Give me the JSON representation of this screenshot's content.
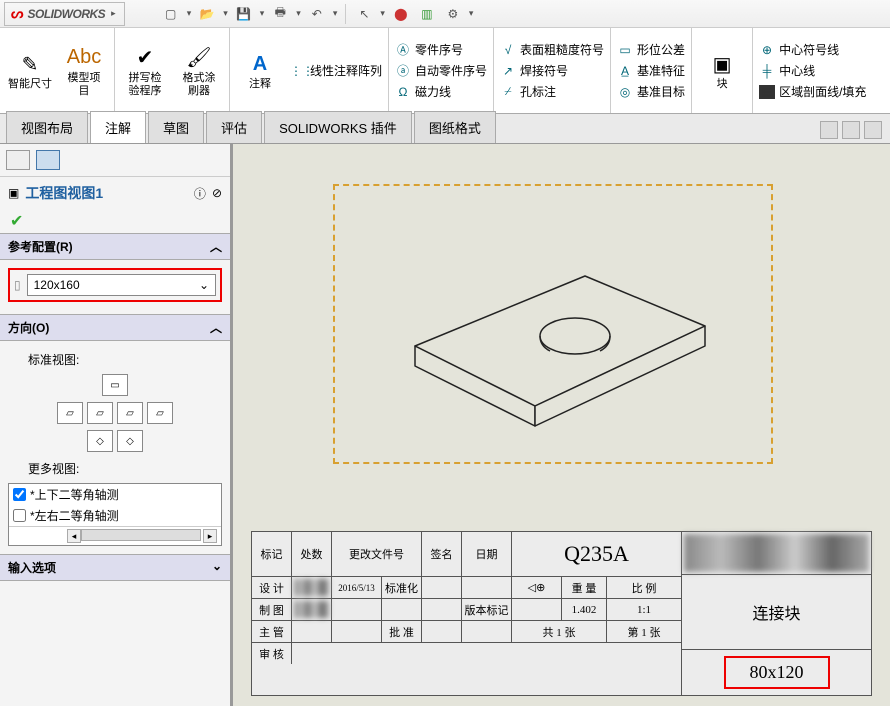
{
  "app": {
    "name": "SOLIDWORKS"
  },
  "toolbar_dd": "▾",
  "ribbon": {
    "groups": {
      "dim": {
        "smart_dim": "智能尺寸",
        "model_items": "模型项\n目"
      },
      "check": {
        "spell": "拼写检\n验程序",
        "format": "格式涂\n刷器"
      },
      "annot": {
        "note": "注释",
        "linear": "线性注释阵列"
      },
      "num": {
        "balloon": "零件序号",
        "auto_balloon": "自动零件序号",
        "magnetic": "磁力线"
      },
      "surf": {
        "surface": "表面粗糙度符号",
        "weld": "焊接符号",
        "hole": "孔标注"
      },
      "gd": {
        "geo_tol": "形位公差",
        "datum": "基准特征",
        "datum_target": "基准目标"
      },
      "blk": {
        "block": "块"
      },
      "center": {
        "center_mark": "中心符号线",
        "centerline": "中心线",
        "hatch": "区域剖面线/填充"
      }
    }
  },
  "tabs": {
    "layout": "视图布局",
    "annot": "注解",
    "sketch": "草图",
    "evaluate": "评估",
    "addins": "SOLIDWORKS 插件",
    "sheet": "图纸格式"
  },
  "panel": {
    "title": "工程图视图1",
    "ref_config": {
      "label": "参考配置(R)",
      "value": "120x160"
    },
    "orientation": {
      "label": "方向(O)",
      "std_views": "标准视图:",
      "more_views": "更多视图:",
      "iso1": "*上下二等角轴测",
      "iso2": "*左右二等角轴测"
    },
    "input_options": "输入选项"
  },
  "drawing": {
    "material": "Q235A",
    "mark": "标记",
    "qty": "处数",
    "change": "更改文件号",
    "sign": "签名",
    "date": "日期",
    "design": "设 计",
    "design_date": "2016/5/13",
    "standard": "标准化",
    "draw": "制 图",
    "version_mark": "版本标记",
    "version": "1.402",
    "scale": "1:1",
    "manage": "主 管",
    "weight": "重 量",
    "ratio": "比 例",
    "check": "审 核",
    "approve": "批 准",
    "total": "共   1   张",
    "page": "第   1   张",
    "part_name": "连接块",
    "part_size": "80x120"
  }
}
